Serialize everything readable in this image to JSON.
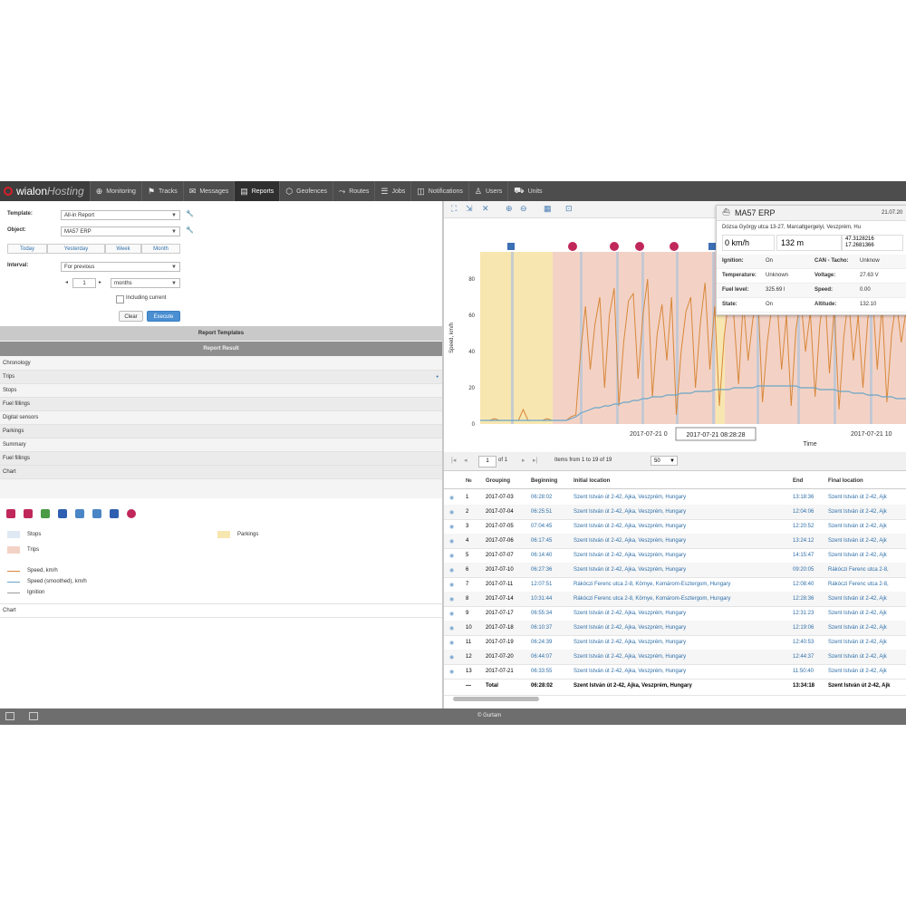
{
  "brand": {
    "name_a": "wialon",
    "name_b": "Hosting"
  },
  "nav": [
    {
      "icon": "⊕",
      "label": "Monitoring"
    },
    {
      "icon": "⚑",
      "label": "Tracks"
    },
    {
      "icon": "✉",
      "label": "Messages"
    },
    {
      "icon": "▤",
      "label": "Reports",
      "active": true
    },
    {
      "icon": "⬡",
      "label": "Geofences"
    },
    {
      "icon": "⤳",
      "label": "Routes"
    },
    {
      "icon": "☰",
      "label": "Jobs"
    },
    {
      "icon": "◫",
      "label": "Notifications"
    },
    {
      "icon": "♙",
      "label": "Users"
    },
    {
      "icon": "⛟",
      "label": "Units"
    }
  ],
  "form": {
    "template_label": "Template:",
    "template_value": "All-in Report",
    "object_label": "Object:",
    "object_value": "MA57 ERP",
    "periods": [
      "Today",
      "Yesterday",
      "Week",
      "Month"
    ],
    "interval_label": "Interval:",
    "interval_value": "For previous",
    "interval_count": "1",
    "interval_unit": "months",
    "including_current": "Including current",
    "clear_label": "Clear",
    "execute_label": "Execute"
  },
  "sections": {
    "templates": "Report Templates",
    "result": "Report Result"
  },
  "result_items": [
    "Chronology",
    "Trips",
    "Stops",
    "Fuel fillings",
    "Digital sensors",
    "Parkings",
    "Summary",
    "Fuel fillings",
    "Chart"
  ],
  "chart_legend": {
    "stops": "Stops",
    "parkings": "Parkings",
    "trips": "Trips",
    "speed": "Speed, km/h",
    "speed_smoothed": "Speed (smoothed), km/h",
    "ignition": "Ignition",
    "chart_footer": "Chart"
  },
  "colors": {
    "parking": "#f8e6b0",
    "trip": "#f3d2c5",
    "stop": "#dfe9f4",
    "speed": "#d8873a",
    "smooth": "#6aa6c8",
    "ignition": "#9a9a9a",
    "marker_red": "#c0275a"
  },
  "chart_data": {
    "type": "line",
    "ylabel": "Speed, km/h",
    "xlabel": "Time",
    "yticks": [
      0,
      20,
      40,
      60,
      80
    ],
    "ylim": [
      0,
      95
    ],
    "x_tick_labels": [
      "2017-07-21 0",
      "2017-07-21 08:28:28",
      "2017-07-21 10"
    ],
    "tooltip_time": "2017-07-21 08:28:28",
    "series": [
      {
        "values": [
          2,
          2,
          2,
          3,
          2,
          2,
          2,
          2,
          2,
          8,
          2,
          2,
          2,
          2,
          3,
          2,
          2,
          2,
          2,
          4,
          5,
          40,
          65,
          30,
          55,
          70,
          20,
          60,
          75,
          10,
          45,
          68,
          72,
          25,
          60,
          80,
          15,
          50,
          66,
          35,
          70,
          5,
          40,
          62,
          70,
          20,
          55,
          78,
          30,
          65,
          10,
          48,
          70,
          60,
          22,
          68,
          35,
          58,
          74,
          12,
          45,
          66,
          70,
          30,
          60,
          10,
          52,
          70,
          40,
          62,
          15,
          55,
          75,
          28,
          64,
          8,
          48,
          70,
          35,
          60,
          20,
          58,
          72,
          30,
          66,
          12,
          50,
          68,
          45,
          62
        ]
      },
      {
        "values": [
          2,
          2,
          2,
          2,
          2,
          2,
          2,
          2,
          2,
          2,
          2,
          2,
          2,
          2,
          2,
          2,
          2,
          2,
          2,
          3,
          4,
          6,
          7,
          8,
          9,
          9,
          10,
          10,
          11,
          11,
          12,
          12,
          13,
          13,
          14,
          14,
          15,
          15,
          15,
          16,
          16,
          16,
          17,
          17,
          17,
          18,
          18,
          18,
          18,
          19,
          19,
          19,
          19,
          20,
          20,
          20,
          20,
          20,
          21,
          21,
          21,
          21,
          21,
          21,
          21,
          21,
          21,
          20,
          20,
          20,
          20,
          19,
          19,
          19,
          19,
          18,
          18,
          18,
          17,
          17,
          17,
          16,
          16,
          16,
          15,
          15,
          15,
          14,
          14,
          14
        ]
      }
    ]
  },
  "popup": {
    "title": "MA57 ERP",
    "date": "21.07.20",
    "address": "Dózsa György utca 13-27, Marcaltgergelyi, Veszprém, Hu",
    "speed": "0 km/h",
    "altitude": "132 m",
    "coords": [
      "47.3128216",
      "17.2681366"
    ],
    "fields": [
      {
        "l": "Ignition:",
        "v": "On",
        "l2": "CAN - Tacho:",
        "v2": "Unknow"
      },
      {
        "l": "Temperature:",
        "v": "Unknown",
        "l2": "Voltage:",
        "v2": "27.63 V"
      },
      {
        "l": "Fuel level:",
        "v": "325.69 l",
        "l2": "Speed:",
        "v2": "0.00"
      },
      {
        "l": "State:",
        "v": "On",
        "l2": "Altitude:",
        "v2": "132.10"
      }
    ]
  },
  "pager": {
    "page": "1",
    "of": "of 1",
    "items": "Items from 1 to 19 of 19",
    "per_page": "50"
  },
  "table": {
    "headers": [
      "№",
      "Grouping",
      "Beginning",
      "Initial location",
      "End",
      "Final location"
    ],
    "rows": [
      [
        "1",
        "2017-07-03",
        "06:28:02",
        "Szent István út 2-42, Ajka, Veszprém, Hungary",
        "13:18:36",
        "Szent István út 2-42, Ajk"
      ],
      [
        "2",
        "2017-07-04",
        "06:25:51",
        "Szent István út 2-42, Ajka, Veszprém, Hungary",
        "12:04:06",
        "Szent István út 2-42, Ajk"
      ],
      [
        "3",
        "2017-07-05",
        "07:04:45",
        "Szent István út 2-42, Ajka, Veszprém, Hungary",
        "12:20:52",
        "Szent István út 2-42, Ajk"
      ],
      [
        "4",
        "2017-07-06",
        "06:17:45",
        "Szent István út 2-42, Ajka, Veszprém, Hungary",
        "13:24:12",
        "Szent István út 2-42, Ajk"
      ],
      [
        "5",
        "2017-07-07",
        "06:14:40",
        "Szent István út 2-42, Ajka, Veszprém, Hungary",
        "14:15:47",
        "Szent István út 2-42, Ajk"
      ],
      [
        "6",
        "2017-07-10",
        "06:27:36",
        "Szent István út 2-42, Ajka, Veszprém, Hungary",
        "09:20:05",
        "Rákóczi Ferenc utca 2-8,"
      ],
      [
        "7",
        "2017-07-11",
        "12:07:51",
        "Rákóczi Ferenc utca 2-8, Környe, Komárom-Esztergom, Hungary",
        "12:08:40",
        "Rákóczi Ferenc utca 2-8,"
      ],
      [
        "8",
        "2017-07-14",
        "10:31:44",
        "Rákóczi Ferenc utca 2-8, Környe, Komárom-Esztergom, Hungary",
        "12:28:36",
        "Szent István út 2-42, Ajk"
      ],
      [
        "9",
        "2017-07-17",
        "06:55:34",
        "Szent István út 2-42, Ajka, Veszprém, Hungary",
        "12:31:23",
        "Szent István út 2-42, Ajk"
      ],
      [
        "10",
        "2017-07-18",
        "06:10:37",
        "Szent István út 2-42, Ajka, Veszprém, Hungary",
        "12:19:06",
        "Szent István út 2-42, Ajk"
      ],
      [
        "11",
        "2017-07-19",
        "06:24:39",
        "Szent István út 2-42, Ajka, Veszprém, Hungary",
        "12:40:53",
        "Szent István út 2-42, Ajk"
      ],
      [
        "12",
        "2017-07-20",
        "06:44:07",
        "Szent István út 2-42, Ajka, Veszprém, Hungary",
        "12:44:37",
        "Szent István út 2-42, Ajk"
      ],
      [
        "13",
        "2017-07-21",
        "06:33:55",
        "Szent István út 2-42, Ajka, Veszprém, Hungary",
        "11:50:40",
        "Szent István út 2-42, Ajk"
      ]
    ],
    "total": {
      "dash": "—",
      "label": "Total",
      "beginning": "06:28:02",
      "initial": "Szent István út 2-42, Ajka, Veszprém, Hungary",
      "end": "13:34:18",
      "final": "Szent István út 2-42, Ajk"
    }
  },
  "footer": {
    "copyright": "© Gurtam"
  }
}
